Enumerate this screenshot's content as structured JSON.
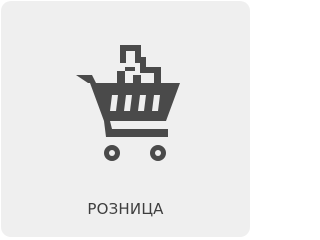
{
  "tile": {
    "label": "РОЗНИЦА",
    "icon": "shopping-cart-with-boxes-icon",
    "background_color": "#efefef",
    "icon_color": "#4a4a4a",
    "text_color": "#3e3e3e"
  }
}
